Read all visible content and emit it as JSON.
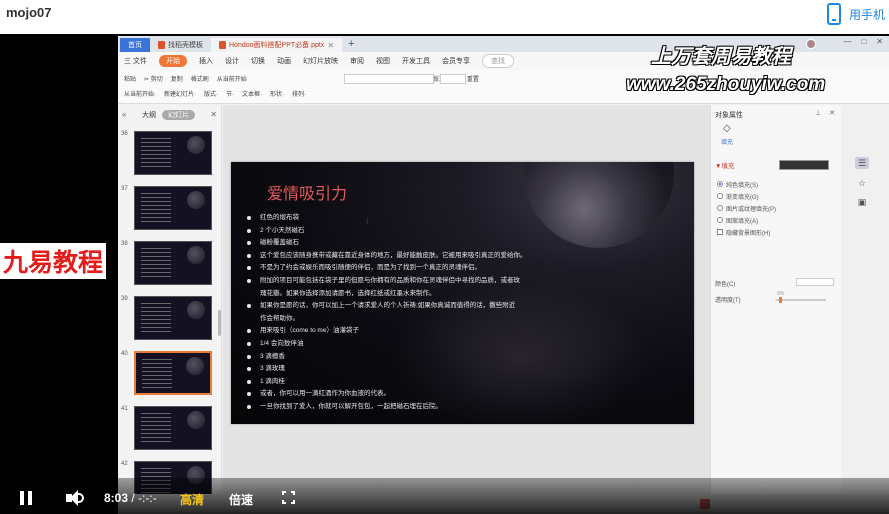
{
  "header": {
    "username": "mojo07",
    "mobile_label": "用手机"
  },
  "window": {
    "tabs": [
      {
        "label": "首页",
        "kind": "home"
      },
      {
        "label": "找稻壳模板",
        "kind": "normal"
      },
      {
        "label": "Hondoo面料搭配PPT必备.pptx",
        "kind": "active"
      }
    ],
    "controls": [
      "—",
      "□",
      "✕"
    ]
  },
  "menu": {
    "items": [
      "三 文件",
      "开始",
      "插入",
      "设计",
      "切换",
      "动画",
      "幻灯片放映",
      "审阅",
      "视图",
      "开发工具",
      "会员专享",
      "查找"
    ],
    "active": "开始"
  },
  "toolbar": {
    "row1": [
      "粘贴",
      "✂ 剪切",
      "复制",
      "格式刷",
      "从当前开始",
      "新建幻灯片",
      "版式",
      "节",
      "重置"
    ],
    "row2": [
      "从当前开始·",
      "新建幻灯片·",
      "版式·",
      "节·",
      "文本框·",
      "形状·",
      "排列·"
    ]
  },
  "thumbnails": {
    "tabs": [
      "大纲",
      "幻灯片"
    ],
    "numbers": [
      "36",
      "37",
      "38",
      "39",
      "40",
      "41",
      "42"
    ],
    "selected_index": 4
  },
  "slide": {
    "title": "爱情吸引力",
    "bullets": [
      {
        "text": "红色的缎布袋",
        "cont": false
      },
      {
        "text": "2 个小天然磁石",
        "cont": false
      },
      {
        "text": "磁粉覆盖磁石",
        "cont": false
      },
      {
        "text": "这个爱包应该随身携带或藏在靠近身体的地方，最好能触皮肤。它被用来吸引真正的爱给你。",
        "cont": false
      },
      {
        "text": "不是为了约会或娱乐而吸引随便的伴侣，而是为了找到一个真正的灵魂伴侣。",
        "cont": false
      },
      {
        "text": "附加的项目可能包括在袋子里的但愿与你拥有的品质和你在灵魂伴侣中寻找的品质，或者玫",
        "cont": false
      },
      {
        "text": "瑰花瓣。如果你选择添加请愿书，选择红纸或红墨水来制作。",
        "cont": true
      },
      {
        "text": "如果你是愿的话，你可以加上一个请求爱人的个人祈祷;如果你真诚而值得的话，撒些附近",
        "cont": false
      },
      {
        "text": "作会帮助你。",
        "cont": true
      },
      {
        "text": "用来吸引（come to me）油灌袋子",
        "cont": false
      },
      {
        "text": "1/4 会向敖伴油",
        "cont": false
      },
      {
        "text": "3 滴檀香",
        "cont": false
      },
      {
        "text": "3 滴玫瑰",
        "cont": false
      },
      {
        "text": "1 滴肉桂",
        "cont": false
      },
      {
        "text": "或者，你可以用一滴红酒作为你血液的代表。",
        "cont": false
      },
      {
        "text": "一旦你找到了爱人，你就可以解开包包，一起把磁石埋在后院。",
        "cont": false
      }
    ]
  },
  "right_pane": {
    "title": "对象属性",
    "fill_tab": "填充",
    "section": "▼填充",
    "options": [
      {
        "label": "纯色填充(S)",
        "on": true,
        "type": "radio"
      },
      {
        "label": "渐变填充(G)",
        "on": false,
        "type": "radio"
      },
      {
        "label": "图片或纹理填充(P)",
        "on": false,
        "type": "radio"
      },
      {
        "label": "图案填充(A)",
        "on": false,
        "type": "radio"
      },
      {
        "label": "隐藏背景图形(H)",
        "on": false,
        "type": "check"
      }
    ],
    "color_label": "颜色(C)",
    "transparency_label": "透明度(T)",
    "transparency_value": "0%"
  },
  "watermarks": {
    "top": "上万套周易教程",
    "url": "www.265zhouyiw.com",
    "left": "九易教程"
  },
  "player": {
    "current_time": "8:03",
    "separator": "/",
    "duration": "-:-:-",
    "quality": "高清",
    "speed": "倍速"
  },
  "colors": {
    "accent_blue": "#1e88e5",
    "quality_yellow": "#f5c518",
    "slide_title": "#e45a5a",
    "watermark_red": "#e51c1c"
  }
}
